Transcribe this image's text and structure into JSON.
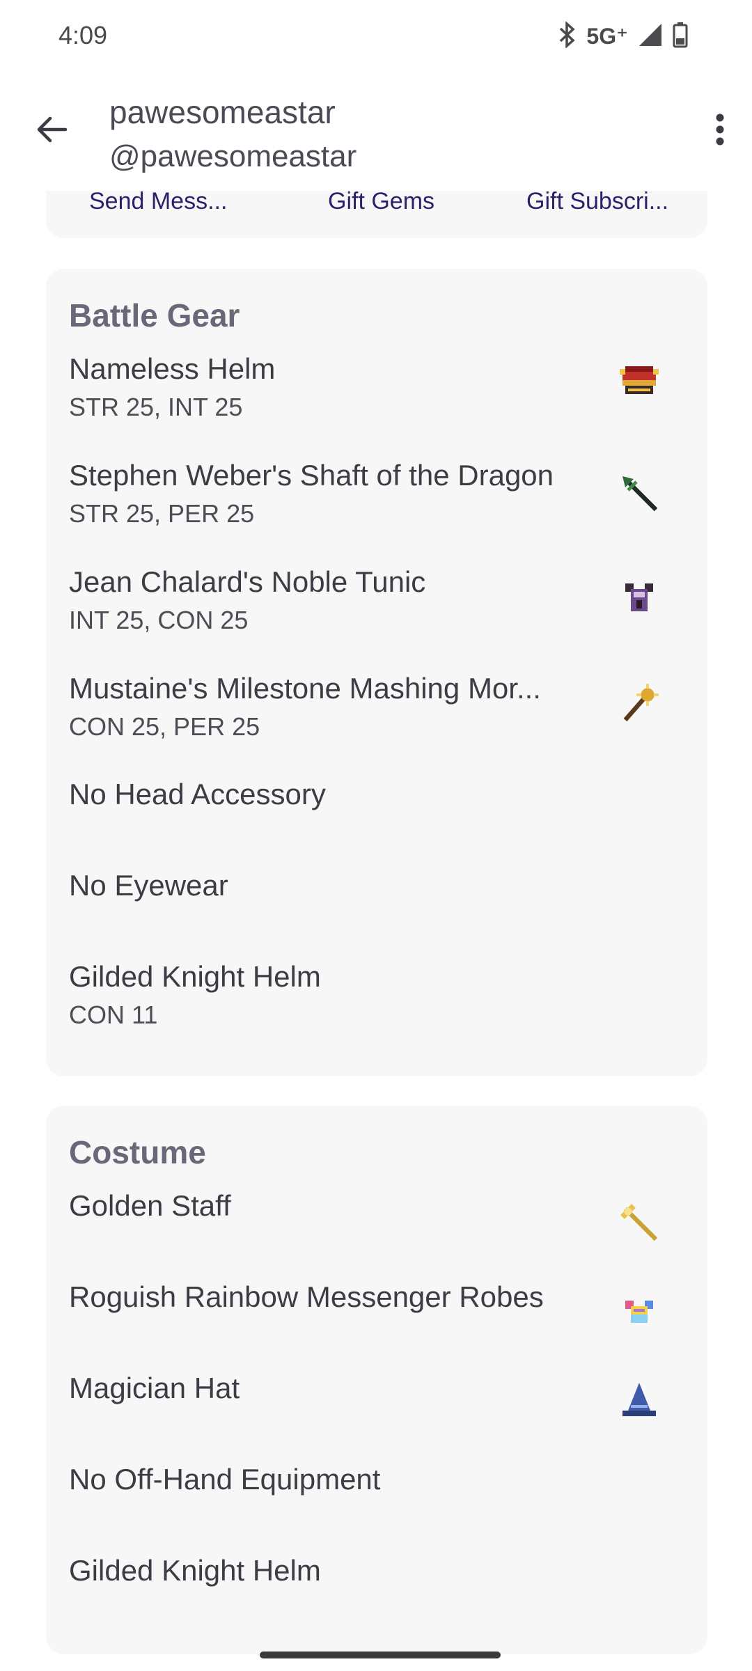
{
  "status": {
    "time": "4:09",
    "network": "5G⁺"
  },
  "header": {
    "title": "pawesomeastar",
    "subtitle": "@pawesomeastar"
  },
  "actions": {
    "send_message": "Send Mess...",
    "gift_gems": "Gift Gems",
    "gift_subscription": "Gift Subscri..."
  },
  "battle_gear": {
    "title": "Battle Gear",
    "items": [
      {
        "name": "Nameless Helm",
        "stats": "STR 25, INT 25",
        "icon": "helm-icon"
      },
      {
        "name": "Stephen Weber's Shaft of the Dragon",
        "stats": "STR 25, PER 25",
        "icon": "spear-icon"
      },
      {
        "name": "Jean Chalard's Noble Tunic",
        "stats": "INT 25, CON 25",
        "icon": "tunic-icon"
      },
      {
        "name": "Mustaine's Milestone Mashing Mor...",
        "stats": "CON 25, PER 25",
        "icon": "morning-star-icon"
      },
      {
        "name": "No Head Accessory",
        "stats": ""
      },
      {
        "name": "No Eyewear",
        "stats": ""
      },
      {
        "name": "Gilded Knight Helm",
        "stats": "CON 11"
      }
    ]
  },
  "costume": {
    "title": "Costume",
    "items": [
      {
        "name": "Golden Staff",
        "icon": "staff-icon"
      },
      {
        "name": "Roguish Rainbow Messenger Robes",
        "icon": "robes-icon"
      },
      {
        "name": "Magician Hat",
        "icon": "wizard-hat-icon"
      },
      {
        "name": "No Off-Hand Equipment"
      },
      {
        "name": "Gilded Knight Helm"
      }
    ]
  }
}
